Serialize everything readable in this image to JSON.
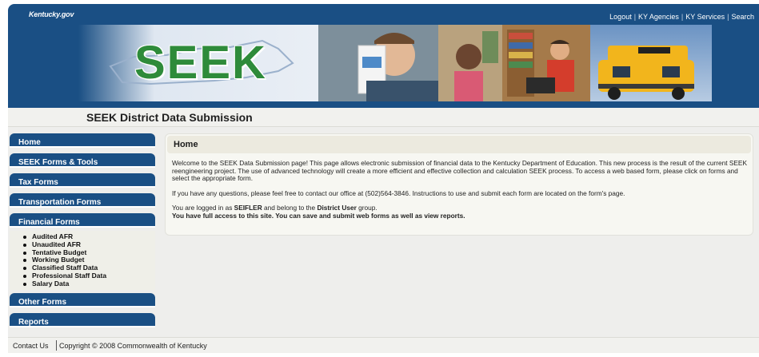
{
  "header": {
    "site_logo": "Kentucky.gov",
    "links": [
      "Logout",
      "KY Agencies",
      "KY Services",
      "Search"
    ],
    "banner_word": "SEEK",
    "colors": {
      "header_blue": "#1a4f84",
      "seek_green": "#2e8b3a"
    }
  },
  "page": {
    "title": "SEEK District Data Submission"
  },
  "sidebar": {
    "items": [
      {
        "label": "Home"
      },
      {
        "label": "SEEK Forms & Tools"
      },
      {
        "label": "Tax Forms"
      },
      {
        "label": "Transportation Forms"
      },
      {
        "label": "Financial Forms"
      },
      {
        "label": "Other Forms"
      },
      {
        "label": "Reports"
      }
    ],
    "financial_subitems": [
      "Audited AFR",
      "Unaudited AFR",
      "Tentative Budget",
      "Working Budget",
      "Classified Staff Data",
      "Professional Staff Data",
      "Salary Data"
    ]
  },
  "content": {
    "heading": "Home",
    "para1": "Welcome to the SEEK Data Submission page! This page allows electronic submission of financial data to the Kentucky Department of Education. This new process is the result of the current SEEK reengineering project. The use of advanced technology will create a more efficient and effective collection and calculation SEEK process. To access a web based form, please click on forms and select the appropriate form.",
    "para2": "If you have any questions, please feel free to contact our office at (502)564-3846. Instructions to use and submit each form are located on the form's page.",
    "login_prefix": "You are logged in as ",
    "user": "SEIFLER",
    "login_mid": " and belong to the ",
    "group": "District User",
    "login_suffix": " group.",
    "access_note": "You have full access to this site. You can save and submit web forms as well as view reports."
  },
  "footer": {
    "contact": "Contact Us",
    "copyright": "Copyright © 2008 Commonwealth of Kentucky"
  }
}
